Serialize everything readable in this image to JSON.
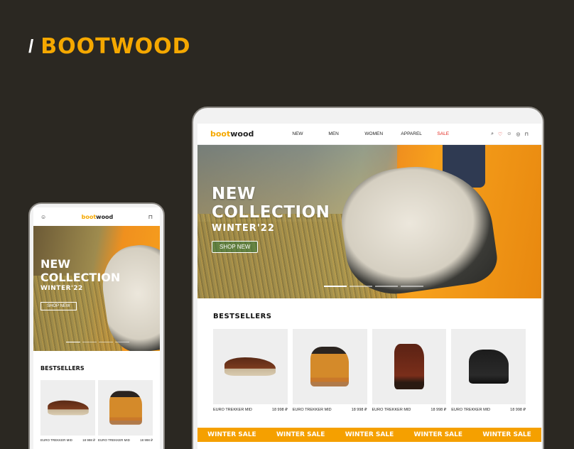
{
  "brand": {
    "slash": "/",
    "name": "BOOTWOOD"
  },
  "site": {
    "logo_main": "boot",
    "logo_accent": "wood",
    "nav": [
      "NEW",
      "MEN",
      "WOMEN",
      "APPAREL",
      "SALE"
    ],
    "icons": [
      "search-icon",
      "heart-icon",
      "user-icon",
      "location-icon",
      "cart-icon"
    ],
    "hero": {
      "line1": "NEW",
      "line2": "COLLECTION",
      "line3": "WINTER'22",
      "cta": "SHOP NEW"
    },
    "bestsellers_title": "BESTSELLERS",
    "products": [
      {
        "name": "EURO TREKKER MID",
        "price": "18 998 ₽"
      },
      {
        "name": "EURO TREKKER MID",
        "price": "18 998 ₽"
      },
      {
        "name": "EURO TREKKER MID",
        "price": "18 998 ₽"
      },
      {
        "name": "EURO TREKKER MID",
        "price": "18 998 ₽"
      }
    ],
    "ticker": [
      "WINTER SALE",
      "WINTER SALE",
      "WINTER SALE",
      "WINTER SALE",
      "WINTER SALE"
    ]
  },
  "colors": {
    "accent": "#f5a800",
    "sale": "#e2261d",
    "background": "#2b2822"
  }
}
